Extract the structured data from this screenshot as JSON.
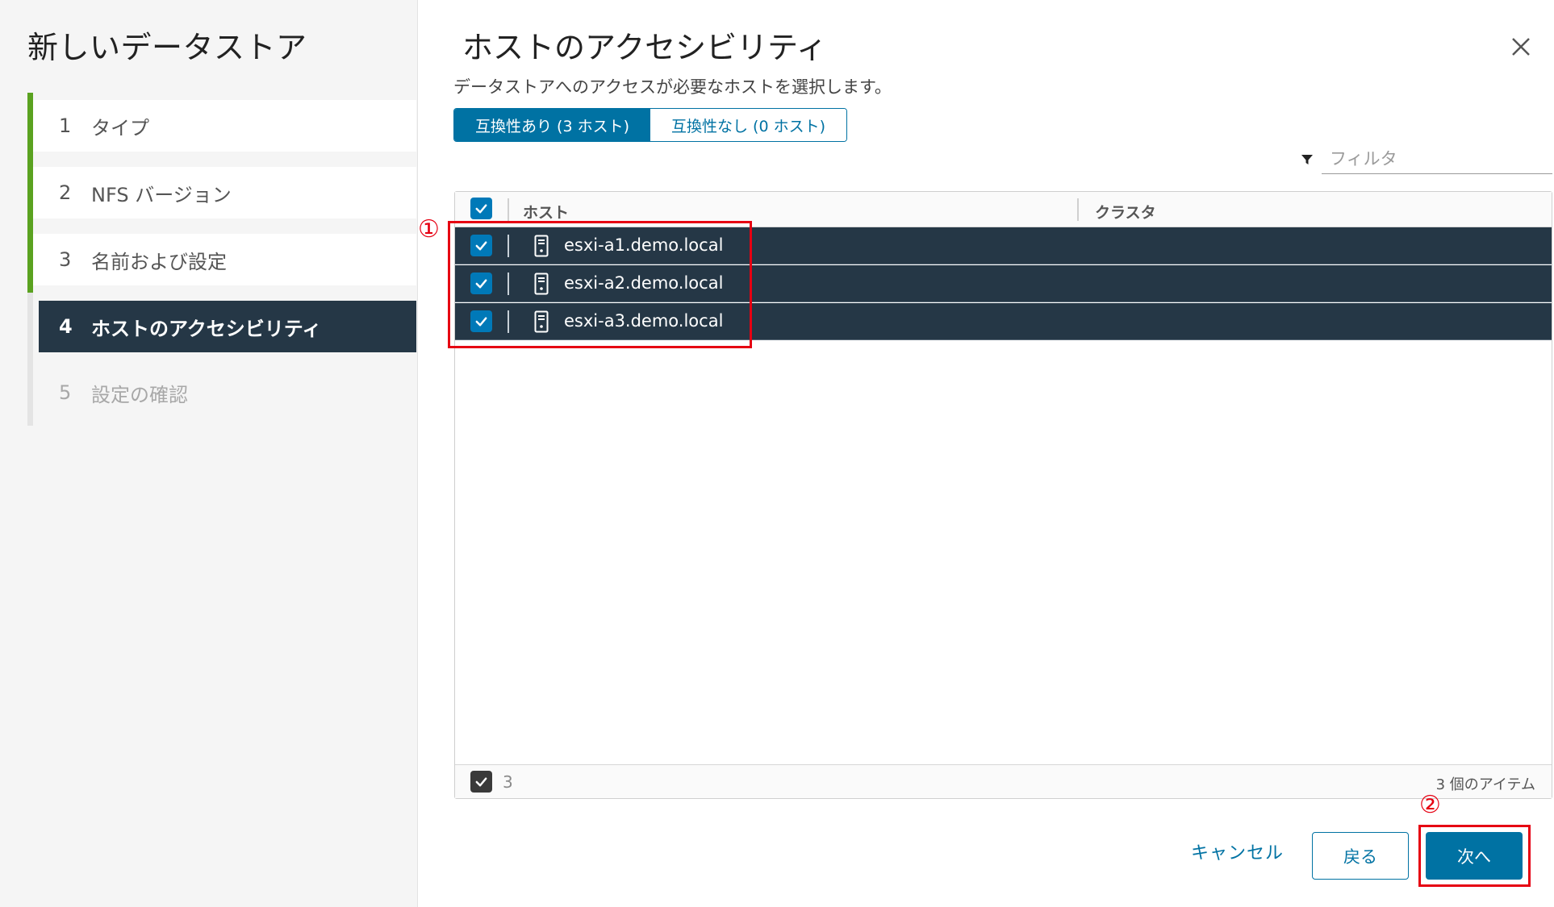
{
  "wizard": {
    "title": "新しいデータストア",
    "steps": [
      {
        "num": "1",
        "label": "タイプ"
      },
      {
        "num": "2",
        "label": "NFS バージョン"
      },
      {
        "num": "3",
        "label": "名前および設定"
      },
      {
        "num": "4",
        "label": "ホストのアクセシビリティ"
      },
      {
        "num": "5",
        "label": "設定の確認"
      }
    ]
  },
  "main": {
    "title": "ホストのアクセシビリティ",
    "description": "データストアへのアクセスが必要なホストを選択します。",
    "segments": {
      "compatible": "互換性あり (3 ホスト)",
      "incompatible": "互換性なし (0 ホスト)"
    },
    "filter_placeholder": "フィルタ",
    "grid": {
      "columns": [
        "ホスト",
        "クラスタ"
      ],
      "rows": [
        {
          "host": "esxi-a1.demo.local",
          "cluster": ""
        },
        {
          "host": "esxi-a2.demo.local",
          "cluster": ""
        },
        {
          "host": "esxi-a3.demo.local",
          "cluster": ""
        }
      ],
      "selected_count": "3",
      "items_label": "3 個のアイテム"
    }
  },
  "buttons": {
    "cancel": "キャンセル",
    "back": "戻る",
    "next": "次へ"
  },
  "annotations": {
    "marker_1": "①",
    "marker_2": "②"
  },
  "colors": {
    "accent": "#0072a3",
    "selected_row": "#253746",
    "progress_green": "#5aa220",
    "annotation_red": "#e60012"
  }
}
